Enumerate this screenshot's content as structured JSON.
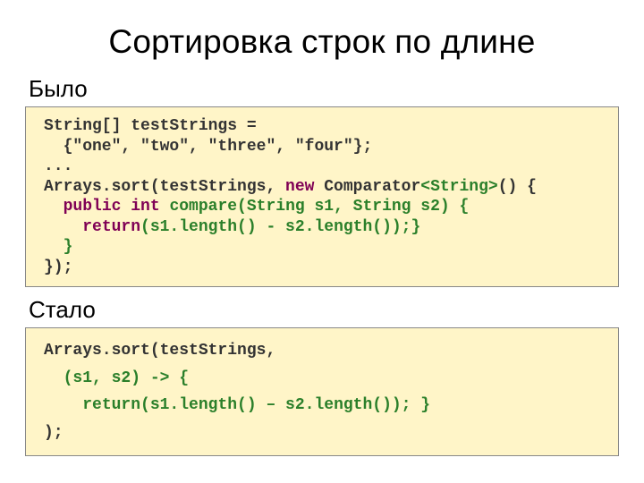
{
  "title": "Сортировка строк по длине",
  "label_before": "Было",
  "label_after": "Стало",
  "code1": {
    "l1": "String[] testStrings = ",
    "l2": "  {\"one\", \"two\", \"three\", \"four\"};",
    "l3": "...",
    "l4a": "Arrays.sort(testStrings, ",
    "l4_new": "new",
    "l4b": " Comparator",
    "l4_gen": "<String>",
    "l4c": "() {",
    "l5_ind": "  ",
    "l5_kw": "public int",
    "l5_rest": " compare(String s1, String s2) {",
    "l6_ind": "    ",
    "l6_kw": "return",
    "l6_rest": "(s1.length() - s2.length());}",
    "l7": "  }",
    "l8": "});"
  },
  "code2": {
    "l1": "Arrays.sort(testStrings,",
    "l2_ind": "  ",
    "l2_hl": "(s1, s2) -> {",
    "l3_ind": "    ",
    "l3_hl": "return(s1.length() – s2.length()); }",
    "l4": ");"
  }
}
